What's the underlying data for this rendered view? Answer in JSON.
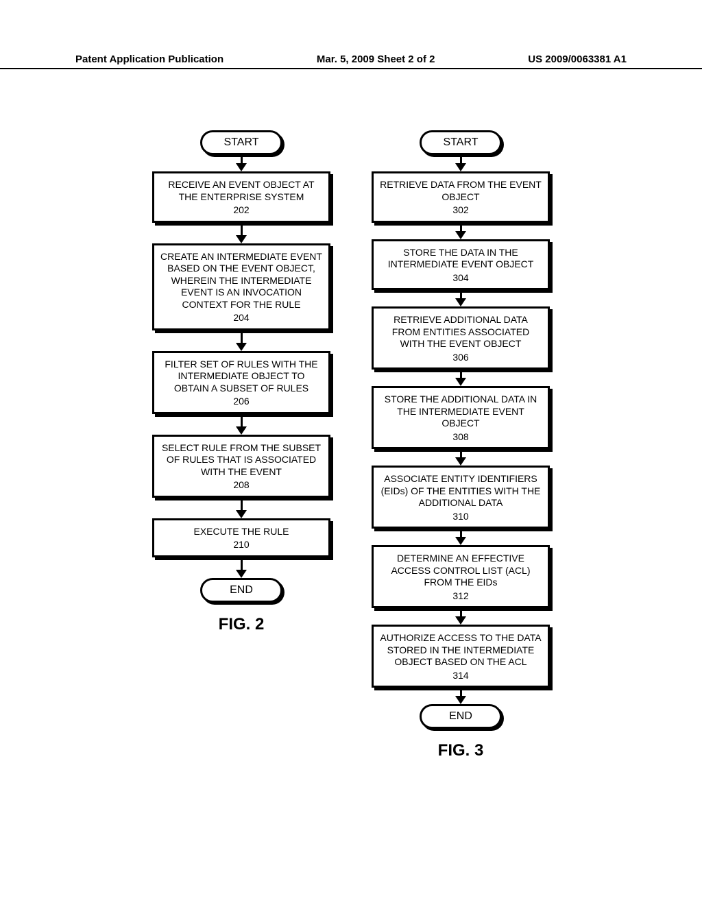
{
  "header": {
    "left": "Patent Application Publication",
    "center": "Mar. 5, 2009  Sheet 2 of 2",
    "right": "US 2009/0063381 A1"
  },
  "fig2": {
    "start": "START",
    "end": "END",
    "label": "FIG. 2",
    "steps": [
      {
        "text": "RECEIVE AN EVENT OBJECT AT THE ENTERPRISE SYSTEM",
        "num": "202"
      },
      {
        "text": "CREATE AN INTERMEDIATE EVENT BASED ON THE EVENT OBJECT, WHEREIN THE INTERMEDIATE EVENT IS AN INVOCATION CONTEXT FOR THE RULE",
        "num": "204"
      },
      {
        "text": "FILTER SET OF RULES WITH THE INTERMEDIATE OBJECT TO OBTAIN A SUBSET OF RULES",
        "num": "206"
      },
      {
        "text": "SELECT RULE FROM THE SUBSET OF RULES THAT IS ASSOCIATED WITH THE EVENT",
        "num": "208"
      },
      {
        "text": "EXECUTE THE RULE",
        "num": "210"
      }
    ]
  },
  "fig3": {
    "start": "START",
    "end": "END",
    "label": "FIG. 3",
    "steps": [
      {
        "text": "RETRIEVE DATA FROM THE EVENT OBJECT",
        "num": "302"
      },
      {
        "text": "STORE THE DATA IN THE INTERMEDIATE EVENT OBJECT",
        "num": "304"
      },
      {
        "text": "RETRIEVE ADDITIONAL DATA FROM ENTITIES ASSOCIATED WITH THE EVENT OBJECT",
        "num": "306"
      },
      {
        "text": "STORE THE ADDITIONAL DATA IN THE INTERMEDIATE EVENT OBJECT",
        "num": "308"
      },
      {
        "text": "ASSOCIATE ENTITY IDENTIFIERS (EIDs) OF THE ENTITIES WITH THE ADDITIONAL DATA",
        "num": "310"
      },
      {
        "text": "DETERMINE AN EFFECTIVE ACCESS CONTROL LIST (ACL) FROM THE EIDs",
        "num": "312"
      },
      {
        "text": "AUTHORIZE ACCESS TO THE DATA STORED IN THE INTERMEDIATE OBJECT BASED ON THE ACL",
        "num": "314"
      }
    ]
  }
}
